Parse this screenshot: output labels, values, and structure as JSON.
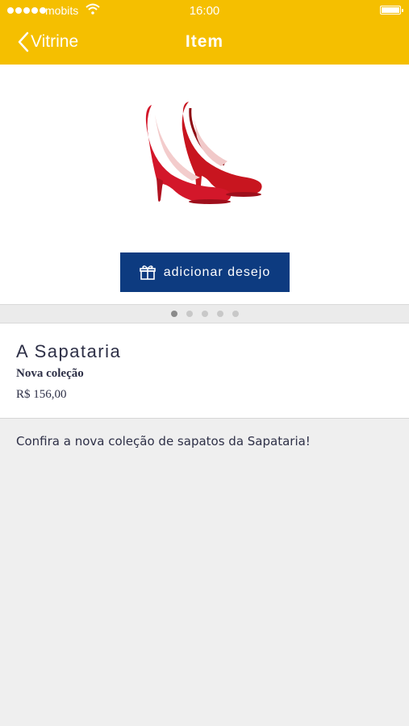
{
  "status_bar": {
    "carrier": "mobits",
    "time": "16:00"
  },
  "nav": {
    "back_label": "Vitrine",
    "title": "Item"
  },
  "product": {
    "image_icon": "red-high-heels",
    "wish_button_label": "adicionar desejo",
    "carousel": {
      "total": 5,
      "active_index": 0
    },
    "store_name": "A Sapataria",
    "collection": "Nova coleção",
    "price": "R$  156,00",
    "description": "Confira a nova coleção de sapatos da Sapataria!"
  },
  "colors": {
    "header": "#f5bf00",
    "button": "#0d3b80",
    "text": "#2e3047"
  }
}
